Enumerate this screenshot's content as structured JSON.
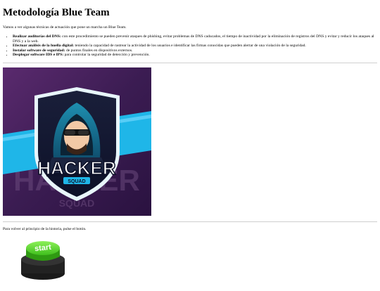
{
  "page": {
    "title": "Metodología Blue Team",
    "intro": "Vamos a ver algunas técnicas de actuación que pone un marcha un Blue Team.",
    "items": [
      {
        "term": "Realizar auditorías del DNS:",
        "text": " con este procedimiento se pueden prevenir ataques de phishing, evitar problemas de DNS caducados, el tiempo de inactividad por la eliminación de registros del DNS y evitar y reducir los ataques al DNS y a la web."
      },
      {
        "term": "Efectuar análisis de la huella digital:",
        "text": " teniendo la capacidad de rastrear la actividad de los usuarios e identificar las firmas conocidas que pueden alertar de una violación de la seguridad."
      },
      {
        "term": "Instalar software de seguridad:",
        "text": " de puntos finales en dispositivos externos."
      },
      {
        "term": "Desplegar software IDS e IPS:",
        "text": " para controlar la seguridad de detección y prevención."
      }
    ],
    "image": {
      "logo_text": "HACKER",
      "badge_text": "SQUAD"
    },
    "back_text": "Para volver al principio de la historia, pulse el botón.",
    "start_button": {
      "label": "start"
    }
  }
}
